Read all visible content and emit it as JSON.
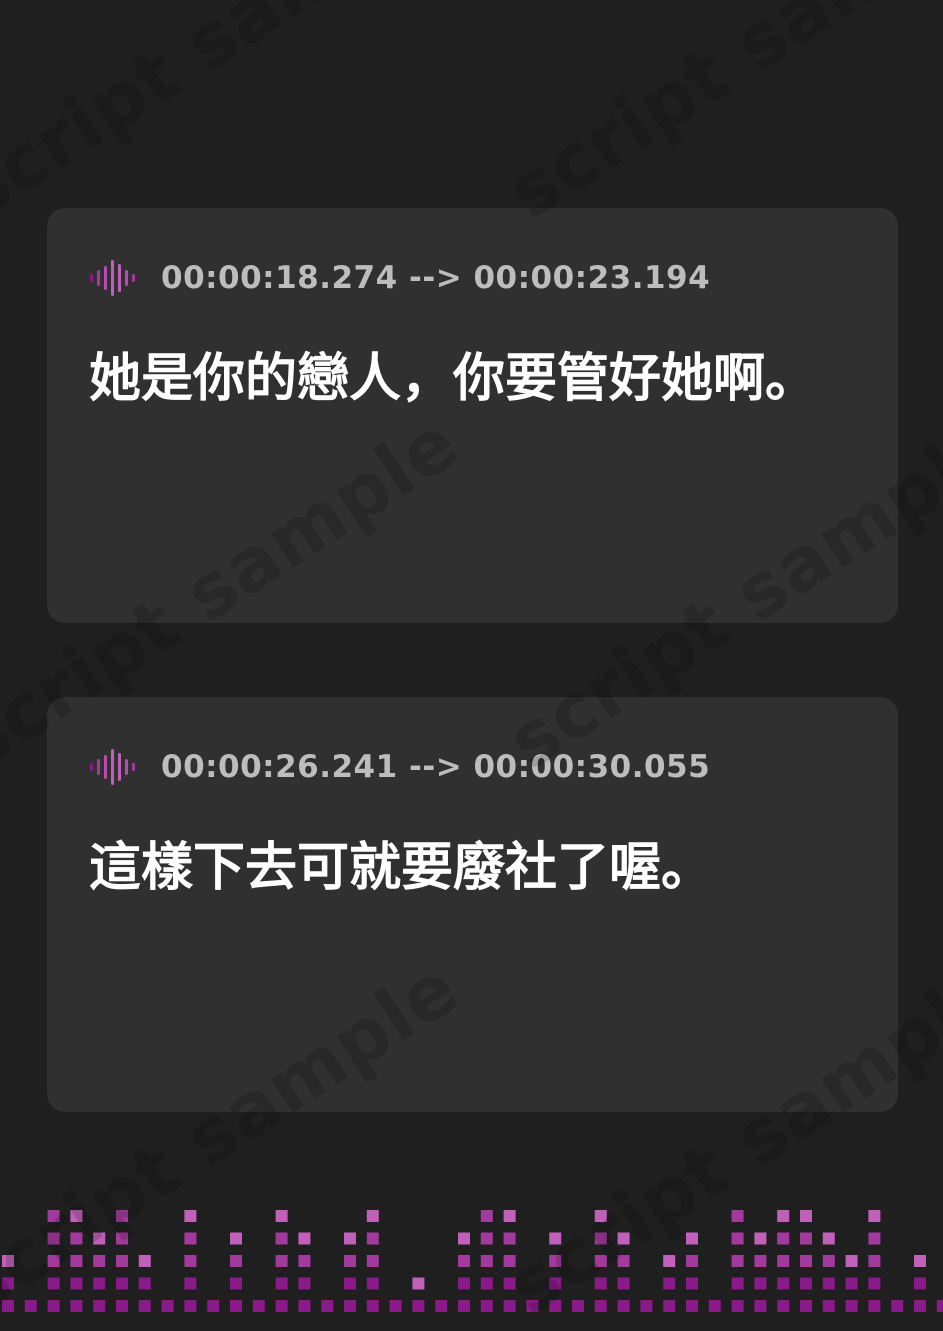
{
  "watermark_text": "script sample",
  "cues": [
    {
      "timestamp": "00:00:18.274 --> 00:00:23.194",
      "text": "她是你的戀人，你要管好她啊。",
      "icon": "audio-wave-icon"
    },
    {
      "timestamp": "00:00:26.241 --> 00:00:30.055",
      "text": "這樣下去可就要廢社了喔。",
      "icon": "audio-wave-icon"
    }
  ],
  "colors": {
    "background": "#1f1f1f",
    "card": "#303030",
    "timestamp": "#bdbdbd",
    "subtitle": "#ffffff",
    "accent_dark": "#8a1a8a",
    "accent_mid": "#a23a9e",
    "accent_light": "#c060b8"
  },
  "equalizer": {
    "icon": "equalizer-visualizer",
    "levels": [
      2,
      0,
      5,
      4,
      3,
      5,
      2,
      0,
      4,
      0,
      3,
      0,
      4,
      3,
      0,
      3,
      4,
      0,
      1,
      0,
      3,
      5,
      4,
      0,
      3,
      0,
      4,
      3,
      0,
      2,
      3,
      0,
      5,
      3,
      4,
      4,
      3,
      2,
      4,
      0,
      2,
      0,
      2,
      0,
      0,
      3
    ]
  }
}
